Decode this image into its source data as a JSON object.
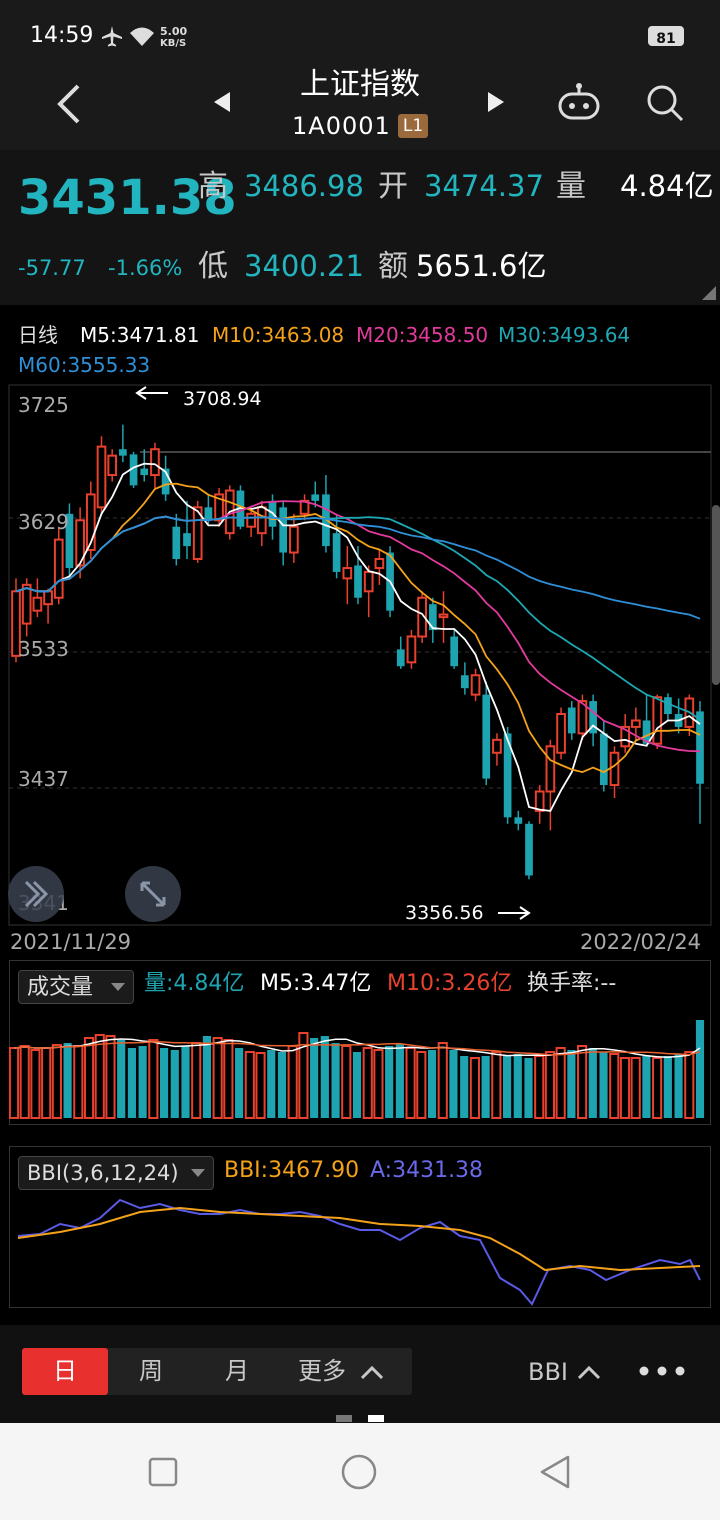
{
  "status": {
    "time": "14:59",
    "speed_top": "5.00",
    "speed_bottom": "KB/S",
    "battery": "81"
  },
  "nav": {
    "title": "上证指数",
    "code": "1A0001",
    "level": "L1"
  },
  "quote": {
    "price": "3431.38",
    "change": "-57.77",
    "change_pct": "-1.66%",
    "high_label": "高",
    "high": "3486.98",
    "open_label": "开",
    "open": "3474.37",
    "vol_label": "量",
    "vol": "4.84亿",
    "low_label": "低",
    "low": "3400.21",
    "amt_label": "额",
    "amt": "5651.6亿"
  },
  "ma_legend": {
    "period": "日线",
    "m5": "M5:3471.81",
    "m10": "M10:3463.08",
    "m20": "M20:3458.50",
    "m30": "M30:3493.64",
    "m60": "M60:3555.33"
  },
  "colors": {
    "up": "#e8412e",
    "down": "#1ea3b1",
    "m5": "#ffffff",
    "m10": "#f4a21a",
    "m20": "#e23a9c",
    "m30": "#1ea8b4",
    "m60": "#2f8fd6",
    "bbi": "#f4a21a",
    "a_line": "#5a5ae6"
  },
  "axis": {
    "y_labels": [
      "3725",
      "3629",
      "3533",
      "3437",
      "3341"
    ],
    "date_start": "2021/11/29",
    "date_end": "2022/02/24",
    "max_label": "3708.94",
    "min_label": "3356.56"
  },
  "volume_panel": {
    "selector": "成交量",
    "vol": "量:4.84亿",
    "m5": "M5:3.47亿",
    "m10": "M10:3.26亿",
    "turnover": "换手率:--"
  },
  "bbi_panel": {
    "selector": "BBI(3,6,12,24)",
    "bbi": "BBI:3467.90",
    "a": "A:3431.38"
  },
  "tabs": {
    "day": "日",
    "week": "周",
    "month": "月",
    "more": "更多",
    "indicator": "BBI"
  },
  "icons": [
    "back-arrow-icon",
    "prev-triangle-icon",
    "next-triangle-icon",
    "robot-icon",
    "search-icon",
    "double-chevron-icon",
    "expand-icon",
    "more-dots-icon",
    "square-icon",
    "circle-icon",
    "back-triangle-icon"
  ],
  "chart_data": {
    "type": "candlestick",
    "candles": [
      {
        "o": 3530,
        "h": 3590,
        "l": 3525,
        "c": 3580
      },
      {
        "o": 3555,
        "h": 3590,
        "l": 3545,
        "c": 3585
      },
      {
        "o": 3565,
        "h": 3590,
        "l": 3560,
        "c": 3575
      },
      {
        "o": 3570,
        "h": 3582,
        "l": 3555,
        "c": 3580
      },
      {
        "o": 3575,
        "h": 3630,
        "l": 3570,
        "c": 3620
      },
      {
        "o": 3640,
        "h": 3648,
        "l": 3590,
        "c": 3598
      },
      {
        "o": 3600,
        "h": 3645,
        "l": 3590,
        "c": 3635
      },
      {
        "o": 3612,
        "h": 3665,
        "l": 3605,
        "c": 3655
      },
      {
        "o": 3645,
        "h": 3700,
        "l": 3640,
        "c": 3692
      },
      {
        "o": 3670,
        "h": 3690,
        "l": 3665,
        "c": 3685
      },
      {
        "o": 3690,
        "h": 3709,
        "l": 3680,
        "c": 3685
      },
      {
        "o": 3686,
        "h": 3688,
        "l": 3660,
        "c": 3662
      },
      {
        "o": 3675,
        "h": 3690,
        "l": 3665,
        "c": 3670
      },
      {
        "o": 3670,
        "h": 3695,
        "l": 3660,
        "c": 3690
      },
      {
        "o": 3675,
        "h": 3685,
        "l": 3650,
        "c": 3655
      },
      {
        "o": 3630,
        "h": 3640,
        "l": 3600,
        "c": 3605
      },
      {
        "o": 3625,
        "h": 3650,
        "l": 3605,
        "c": 3615
      },
      {
        "o": 3605,
        "h": 3650,
        "l": 3602,
        "c": 3645
      },
      {
        "o": 3645,
        "h": 3655,
        "l": 3632,
        "c": 3635
      },
      {
        "o": 3635,
        "h": 3660,
        "l": 3630,
        "c": 3655
      },
      {
        "o": 3625,
        "h": 3662,
        "l": 3620,
        "c": 3658
      },
      {
        "o": 3658,
        "h": 3662,
        "l": 3628,
        "c": 3630
      },
      {
        "o": 3630,
        "h": 3645,
        "l": 3622,
        "c": 3640
      },
      {
        "o": 3625,
        "h": 3650,
        "l": 3615,
        "c": 3645
      },
      {
        "o": 3650,
        "h": 3655,
        "l": 3620,
        "c": 3630
      },
      {
        "o": 3645,
        "h": 3650,
        "l": 3600,
        "c": 3610
      },
      {
        "o": 3610,
        "h": 3640,
        "l": 3602,
        "c": 3630
      },
      {
        "o": 3640,
        "h": 3655,
        "l": 3635,
        "c": 3650
      },
      {
        "o": 3655,
        "h": 3665,
        "l": 3645,
        "c": 3650
      },
      {
        "o": 3655,
        "h": 3670,
        "l": 3610,
        "c": 3615
      },
      {
        "o": 3625,
        "h": 3640,
        "l": 3590,
        "c": 3595
      },
      {
        "o": 3590,
        "h": 3615,
        "l": 3570,
        "c": 3598
      },
      {
        "o": 3600,
        "h": 3615,
        "l": 3570,
        "c": 3575
      },
      {
        "o": 3580,
        "h": 3600,
        "l": 3560,
        "c": 3595
      },
      {
        "o": 3598,
        "h": 3612,
        "l": 3585,
        "c": 3605
      },
      {
        "o": 3610,
        "h": 3615,
        "l": 3560,
        "c": 3565
      },
      {
        "o": 3535,
        "h": 3545,
        "l": 3520,
        "c": 3522
      },
      {
        "o": 3525,
        "h": 3550,
        "l": 3520,
        "c": 3545
      },
      {
        "o": 3545,
        "h": 3580,
        "l": 3540,
        "c": 3575
      },
      {
        "o": 3570,
        "h": 3575,
        "l": 3540,
        "c": 3550
      },
      {
        "o": 3560,
        "h": 3580,
        "l": 3540,
        "c": 3562
      },
      {
        "o": 3545,
        "h": 3550,
        "l": 3520,
        "c": 3522
      },
      {
        "o": 3515,
        "h": 3525,
        "l": 3500,
        "c": 3505
      },
      {
        "o": 3500,
        "h": 3520,
        "l": 3495,
        "c": 3515
      },
      {
        "o": 3500,
        "h": 3510,
        "l": 3430,
        "c": 3435
      },
      {
        "o": 3455,
        "h": 3470,
        "l": 3445,
        "c": 3465
      },
      {
        "o": 3470,
        "h": 3475,
        "l": 3400,
        "c": 3405
      },
      {
        "o": 3405,
        "h": 3410,
        "l": 3395,
        "c": 3400
      },
      {
        "o": 3400,
        "h": 3402,
        "l": 3357,
        "c": 3360
      },
      {
        "o": 3410,
        "h": 3430,
        "l": 3400,
        "c": 3425
      },
      {
        "o": 3425,
        "h": 3465,
        "l": 3395,
        "c": 3460
      },
      {
        "o": 3455,
        "h": 3490,
        "l": 3450,
        "c": 3485
      },
      {
        "o": 3490,
        "h": 3495,
        "l": 3465,
        "c": 3470
      },
      {
        "o": 3470,
        "h": 3500,
        "l": 3465,
        "c": 3495
      },
      {
        "o": 3495,
        "h": 3500,
        "l": 3460,
        "c": 3470
      },
      {
        "o": 3470,
        "h": 3480,
        "l": 3425,
        "c": 3430
      },
      {
        "o": 3430,
        "h": 3460,
        "l": 3420,
        "c": 3455
      },
      {
        "o": 3460,
        "h": 3485,
        "l": 3455,
        "c": 3475
      },
      {
        "o": 3475,
        "h": 3490,
        "l": 3465,
        "c": 3480
      },
      {
        "o": 3480,
        "h": 3500,
        "l": 3460,
        "c": 3462
      },
      {
        "o": 3462,
        "h": 3500,
        "l": 3458,
        "c": 3498
      },
      {
        "o": 3498,
        "h": 3501,
        "l": 3480,
        "c": 3485
      },
      {
        "o": 3485,
        "h": 3497,
        "l": 3470,
        "c": 3475
      },
      {
        "o": 3475,
        "h": 3500,
        "l": 3468,
        "c": 3497
      },
      {
        "o": 3487,
        "h": 3495,
        "l": 3400,
        "c": 3431
      }
    ],
    "volume_bars": [
      0.7,
      0.72,
      0.68,
      0.7,
      0.73,
      0.75,
      0.72,
      0.8,
      0.83,
      0.82,
      0.78,
      0.7,
      0.72,
      0.78,
      0.7,
      0.68,
      0.72,
      0.75,
      0.82,
      0.8,
      0.78,
      0.7,
      0.66,
      0.65,
      0.68,
      0.66,
      0.72,
      0.85,
      0.8,
      0.82,
      0.75,
      0.72,
      0.66,
      0.7,
      0.68,
      0.72,
      0.74,
      0.7,
      0.66,
      0.68,
      0.75,
      0.68,
      0.62,
      0.6,
      0.62,
      0.66,
      0.62,
      0.64,
      0.6,
      0.62,
      0.66,
      0.7,
      0.68,
      0.72,
      0.7,
      0.66,
      0.64,
      0.6,
      0.6,
      0.62,
      0.6,
      0.62,
      0.64,
      0.66,
      0.98
    ],
    "ylim": [
      3341,
      3725
    ]
  }
}
